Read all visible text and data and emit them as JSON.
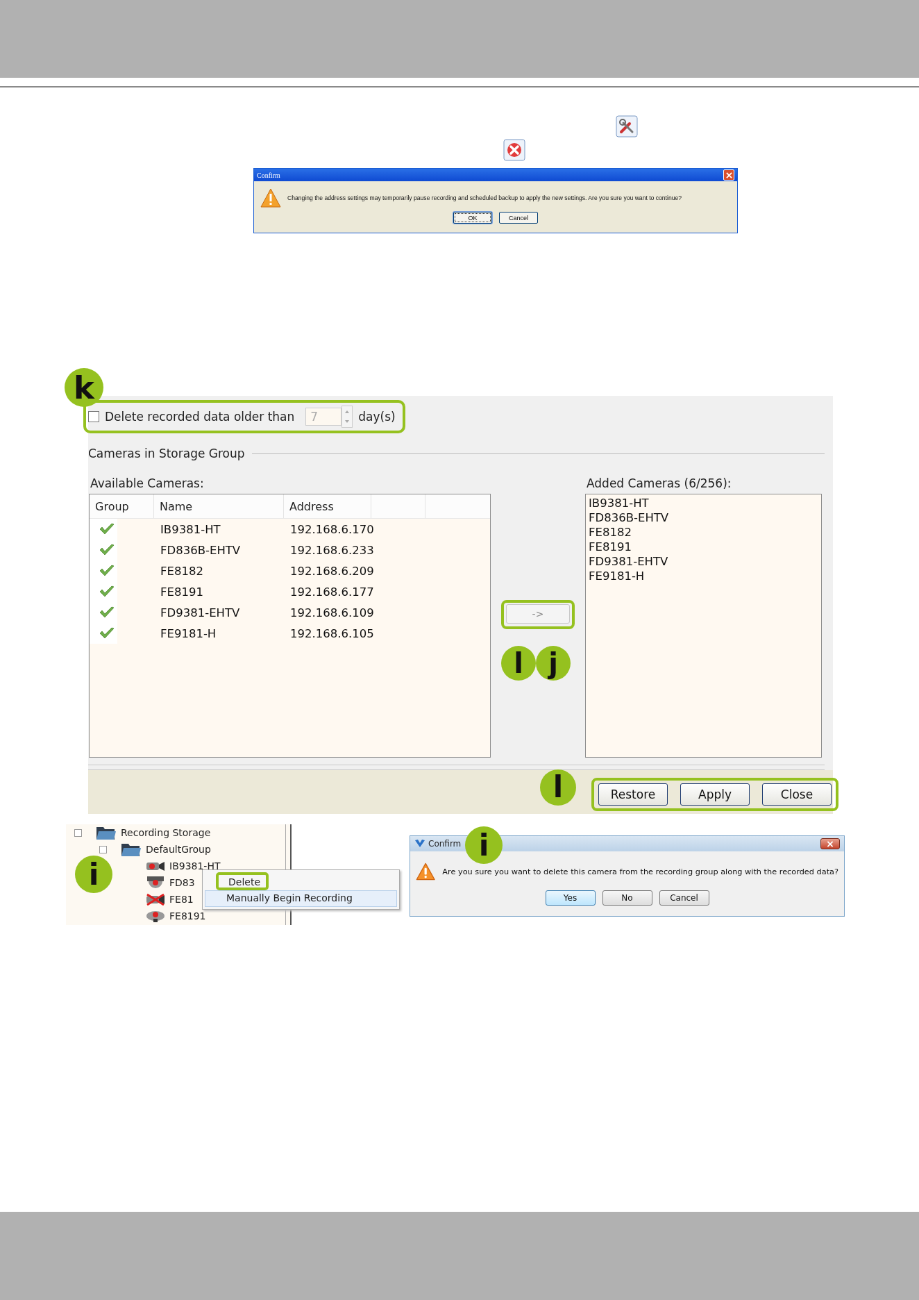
{
  "confirm_dialog_top": {
    "title": "Confirm",
    "message": "Changing the address settings may temporarily pause recording and scheduled backup to apply the new settings. Are you sure you want to continue?",
    "buttons": [
      {
        "label": "OK",
        "selected": true
      },
      {
        "label": "Cancel",
        "selected": false
      }
    ]
  },
  "storage_panel": {
    "retention": {
      "checked": false,
      "outlined": true,
      "label": "Delete recorded data older than",
      "value": "7",
      "unit": "day(s)"
    },
    "group_title": "Cameras in Storage Group",
    "available": {
      "label": "Available Cameras:",
      "columns": [
        "Group",
        "Name",
        "Address"
      ],
      "rows": [
        {
          "name": "IB9381-HT",
          "address": "192.168.6.170"
        },
        {
          "name": "FD836B-EHTV",
          "address": "192.168.6.233"
        },
        {
          "name": "FE8182",
          "address": "192.168.6.209"
        },
        {
          "name": "FE8191",
          "address": "192.168.6.177"
        },
        {
          "name": "FD9381-EHTV",
          "address": "192.168.6.109"
        },
        {
          "name": "FE9181-H",
          "address": "192.168.6.105"
        }
      ]
    },
    "move_button": {
      "label": "->",
      "outlined": true
    },
    "added": {
      "label": "Added Cameras  (6/256):",
      "items": [
        "IB9381-HT",
        "FD836B-EHTV",
        "FE8182",
        "FE8191",
        "FD9381-EHTV",
        "FE9181-H"
      ]
    },
    "buttons_outlined": true,
    "buttons": [
      "Restore",
      "Apply",
      "Close"
    ]
  },
  "tree": {
    "label": "Recording Storage",
    "children": [
      {
        "label": "DefaultGroup",
        "children": [
          {
            "label": "IB9381-HT",
            "kind": "bullet"
          },
          {
            "label": "FD83",
            "kind": "dome"
          },
          {
            "label": "FE81",
            "kind": "offline"
          },
          {
            "label": "FE8191",
            "kind": "fisheye"
          }
        ]
      }
    ]
  },
  "context_menu": [
    {
      "label": "Delete",
      "selected": false,
      "outlined": true
    },
    {
      "label": "Manually Begin Recording",
      "selected": true,
      "outlined": false
    }
  ],
  "confirm_dialog_bottom": {
    "title": "Confirm",
    "message": "Are you sure you want to delete this camera from the recording group along with the recorded data?",
    "buttons": [
      {
        "label": "Yes",
        "selected": true
      },
      {
        "label": "No",
        "selected": false
      },
      {
        "label": "Cancel",
        "selected": false
      }
    ]
  },
  "callouts": [
    "k",
    "l",
    "j",
    "l",
    "i",
    "i"
  ]
}
